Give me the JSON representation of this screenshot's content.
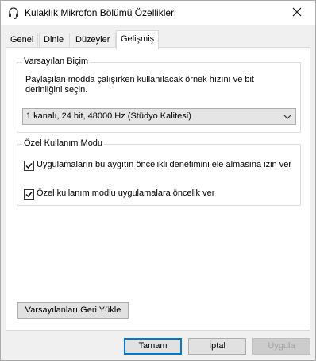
{
  "window": {
    "title": "Kulaklık Mikrofon Bölümü Özellikleri",
    "close_label": "✕"
  },
  "tabs": [
    {
      "label": "Genel"
    },
    {
      "label": "Dinle"
    },
    {
      "label": "Düzeyler"
    },
    {
      "label": "Gelişmiş"
    }
  ],
  "default_format": {
    "legend": "Varsayılan Biçim",
    "description": "Paylaşılan modda çalışırken kullanılacak örnek hızını ve bit derinliğini seçin.",
    "selected": "1 kanalı, 24 bit, 48000 Hz (Stüdyo Kalitesi)"
  },
  "exclusive_mode": {
    "legend": "Özel Kullanım Modu",
    "options": [
      {
        "label": "Uygulamaların bu aygıtın öncelikli denetimini ele almasına izin ver",
        "checked": true
      },
      {
        "label": "Özel kullanım modlu uygulamalara öncelik ver",
        "checked": true
      }
    ]
  },
  "restore_defaults_label": "Varsayılanları Geri Yükle",
  "footer": {
    "ok_label": "Tamam",
    "cancel_label": "İptal",
    "apply_label": "Uygula"
  }
}
